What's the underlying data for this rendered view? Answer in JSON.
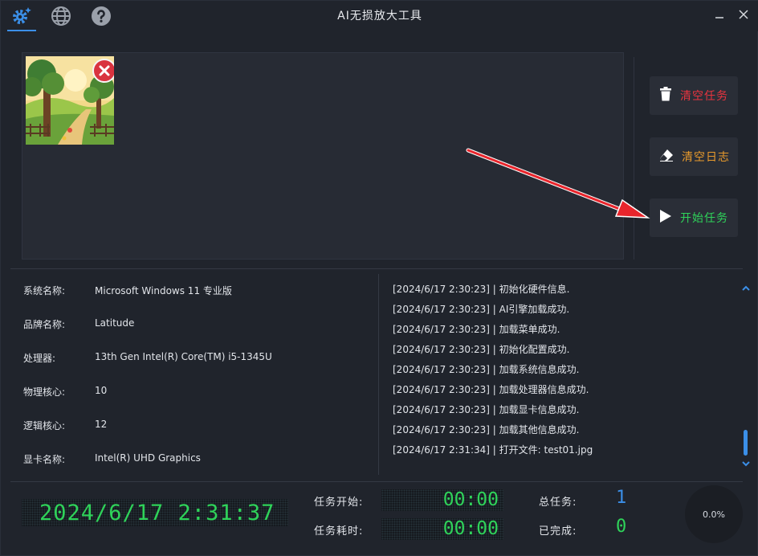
{
  "title": "AI无损放大工具",
  "actions": {
    "clear_tasks": "清空任务",
    "clear_log": "清空日志",
    "start_tasks": "开始任务"
  },
  "colors": {
    "accent": "#3b8fe8",
    "clear_tasks": "#e8343f",
    "clear_log": "#e89a2c",
    "start_tasks": "#2fd35a",
    "led": "#2fd35a",
    "total_count": "#3b8fe8"
  },
  "icons": [
    "settings-icon",
    "globe-icon",
    "help-icon",
    "minimize-icon",
    "close-icon",
    "trash-icon",
    "eraser-icon",
    "play-icon",
    "delete-icon",
    "scroll-up-icon",
    "scroll-down-icon"
  ],
  "system": [
    {
      "key": "系统名称:",
      "value": "Microsoft Windows 11 专业版"
    },
    {
      "key": "品牌名称:",
      "value": "Latitude"
    },
    {
      "key": "处理器:",
      "value": "13th Gen Intel(R) Core(TM) i5-1345U"
    },
    {
      "key": "物理核心:",
      "value": "10"
    },
    {
      "key": "逻辑核心:",
      "value": "12"
    },
    {
      "key": "显卡名称:",
      "value": "Intel(R) UHD Graphics"
    }
  ],
  "log": [
    "[2024/6/17 2:30:23] | 初始化硬件信息.",
    "[2024/6/17 2:30:23] | AI引擎加载成功.",
    "[2024/6/17 2:30:23] | 加载菜单成功.",
    "[2024/6/17 2:30:23] | 初始化配置成功.",
    "[2024/6/17 2:30:23] | 加载系统信息成功.",
    "[2024/6/17 2:30:23] | 加载处理器信息成功.",
    "[2024/6/17 2:30:23] | 加载显卡信息成功.",
    "[2024/6/17 2:30:23] | 加载其他信息成功.",
    "[2024/6/17 2:31:34] | 打开文件: test01.jpg"
  ],
  "status": {
    "clock": "2024/6/17 2:31:37",
    "start_label": "任务开始:",
    "start_value": "00:00",
    "elapsed_label": "任务耗时:",
    "elapsed_value": "00:00",
    "total_label": "总任务:",
    "total_value": "1",
    "done_label": "已完成:",
    "done_value": "0",
    "progress": "0.0%"
  }
}
